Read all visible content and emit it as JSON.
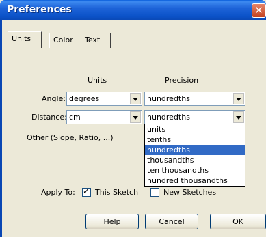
{
  "window": {
    "title": "Preferences",
    "close_glyph": "✕"
  },
  "tabs": [
    {
      "label": "Units"
    },
    {
      "label": "Color"
    },
    {
      "label": "Text"
    }
  ],
  "units_tab": {
    "col_units": "Units",
    "col_precision": "Precision",
    "angle_label": "Angle:",
    "angle_units": "degrees",
    "angle_precision": "hundredths",
    "distance_label": "Distance:",
    "distance_units": "cm",
    "distance_precision": "hundredths",
    "other_label": "Other (Slope, Ratio, ...)",
    "precision_options": [
      "units",
      "tenths",
      "hundredths",
      "thousandths",
      "ten thousandths",
      "hundred thousandths"
    ],
    "selected_option": "hundredths",
    "apply_to_label": "Apply To:",
    "this_sketch_label": "This Sketch",
    "this_sketch_checked": true,
    "new_sketches_label": "New Sketches",
    "new_sketches_checked": false
  },
  "buttons": {
    "help": "Help",
    "cancel": "Cancel",
    "ok": "OK"
  }
}
